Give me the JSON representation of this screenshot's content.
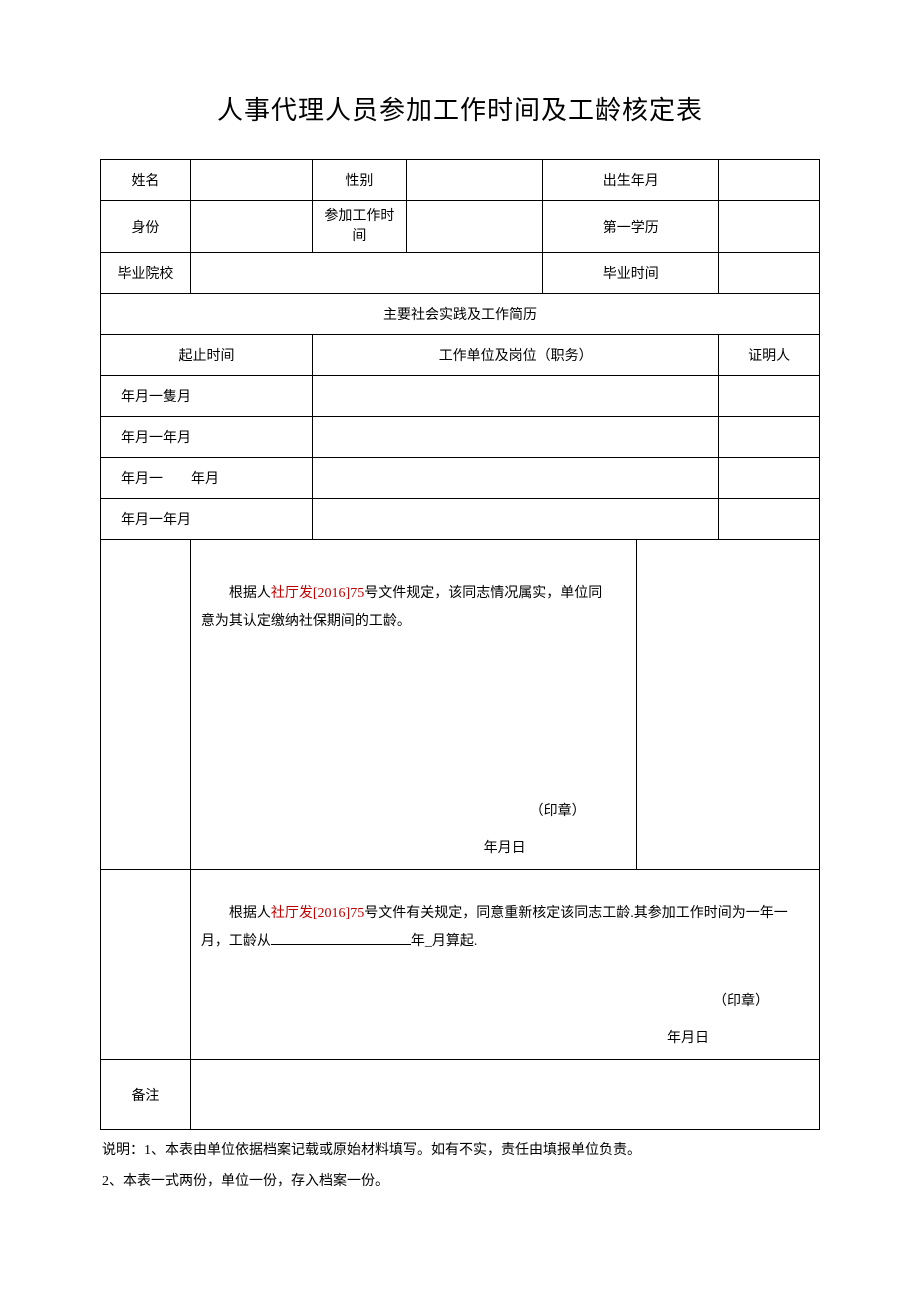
{
  "title": "人事代理人员参加工作时间及工龄核定表",
  "labels": {
    "name": "姓名",
    "gender": "性别",
    "birth": "出生年月",
    "identity": "身份",
    "workStart": "参加工作时间",
    "firstDegree": "第一学历",
    "gradSchool": "毕业院校",
    "gradDate": "毕业时间",
    "resumeHeader": "主要社会实践及工作简历",
    "period": "起止时间",
    "unitPost": "工作单位及岗位（职务）",
    "witness": "证明人",
    "remark": "备注"
  },
  "rows": {
    "r1": "年月一隻月",
    "r2": "年月一年月",
    "r3a": "年月一",
    "r3b": "年月",
    "r4": "年月一年月"
  },
  "opinion1": {
    "pre": "根据人",
    "red": "社厅发[2016]75",
    "post": "号文件规定，该同志情况属实，单位同意为其认定缴纳社保期间的工龄。",
    "stamp": "（印章）",
    "date": "年月日"
  },
  "opinion2": {
    "pre": "根据人",
    "red": "社厅发[2016]75",
    "mid": "号文件有关规定，同意重新核定该同志工龄.其参加工作时间为一年一月，工龄从",
    "tail": "年_月算起.",
    "stamp": "（印章）",
    "date": "年月日"
  },
  "notes": {
    "n1": "说明：1、本表由单位依据档案记载或原始材料填写。如有不实，责任由填报单位负责。",
    "n2": "2、本表一式两份，单位一份，存入档案一份。"
  }
}
